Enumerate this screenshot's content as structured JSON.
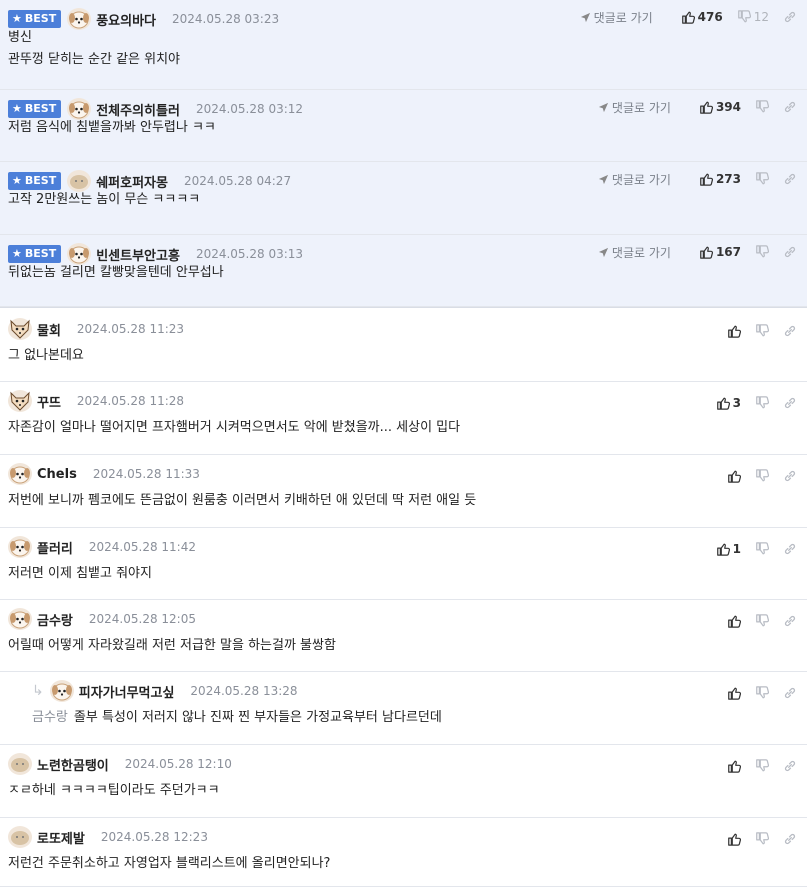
{
  "best_badge": "BEST",
  "goto_label": "댓글로 가기",
  "comments": [
    {
      "nick": "풍요의바다",
      "date": "2024.05.28 03:23",
      "lines": [
        "병신",
        "관뚜껑 닫히는 순간 같은 위치야"
      ],
      "likes": "476",
      "dislikes": "12",
      "best": true,
      "avatar": "dog-face-icon"
    },
    {
      "nick": "전체주의히틀러",
      "date": "2024.05.28 03:12",
      "lines": [
        "저럼 음식에 침뱉을까봐 안두렵나 ㅋㅋ"
      ],
      "likes": "394",
      "best": true,
      "avatar": "dog-face-icon"
    },
    {
      "nick": "쉐퍼호퍼자몽",
      "date": "2024.05.28 04:27",
      "lines": [
        "고작 2만원쓰는 놈이 무슨 ㅋㅋㅋㅋ"
      ],
      "likes": "273",
      "best": true,
      "avatar": "blob-icon"
    },
    {
      "nick": "빈센트부안고흥",
      "date": "2024.05.28 03:13",
      "lines": [
        "뒤없는놈 걸리면 칼빵맞을텐데 안무섭나"
      ],
      "likes": "167",
      "best": true,
      "avatar": "dog-face-icon"
    },
    {
      "nick": "물회",
      "date": "2024.05.28 11:23",
      "lines": [
        "그 없나본데요"
      ],
      "likes": "",
      "avatar": "fox-icon"
    },
    {
      "nick": "꾸뜨",
      "date": "2024.05.28 11:28",
      "lines": [
        "자존감이 얼마나 떨어지면 프자햄버거 시켜먹으면서도 악에 받쳤을까... 세상이 밉다"
      ],
      "likes": "3",
      "avatar": "fox-icon"
    },
    {
      "nick": "Chels",
      "date": "2024.05.28 11:33",
      "lines": [
        "저번에 보니까 펨코에도 뜬금없이 원룸충 이러면서 키배하던 애 있던데 딱 저런 애일 듯"
      ],
      "likes": "",
      "avatar": "dog-face-icon"
    },
    {
      "nick": "플러리",
      "date": "2024.05.28 11:42",
      "lines": [
        "저러면 이제 침뱉고 줘야지"
      ],
      "likes": "1",
      "avatar": "dog-face-icon"
    },
    {
      "nick": "금수랑",
      "date": "2024.05.28 12:05",
      "lines": [
        "어릴때 어떻게 자라왔길래 저런 저급한 말을 하는걸까 불쌍함"
      ],
      "likes": "",
      "avatar": "dog-face-icon"
    },
    {
      "nick": "피자가너무먹고싶",
      "date": "2024.05.28 13:28",
      "lines": [
        "졸부 특성이 저러지 않나 진짜 찐 부자들은 가정교육부터 남다르던데"
      ],
      "likes": "",
      "reply": true,
      "mention": "금수랑",
      "avatar": "dog-face-icon"
    },
    {
      "nick": "노련한곰탱이",
      "date": "2024.05.28 12:10",
      "lines": [
        "ㅈㄹ하네 ㅋㅋㅋㅋ팁이라도 주던가ㅋㅋ"
      ],
      "likes": "",
      "avatar": "blob-icon"
    },
    {
      "nick": "로또제발",
      "date": "2024.05.28 12:23",
      "lines": [
        "저런건 주문취소하고 자영업자 블랙리스트에 올리면안되나?"
      ],
      "likes": "",
      "avatar": "blob-icon"
    }
  ]
}
